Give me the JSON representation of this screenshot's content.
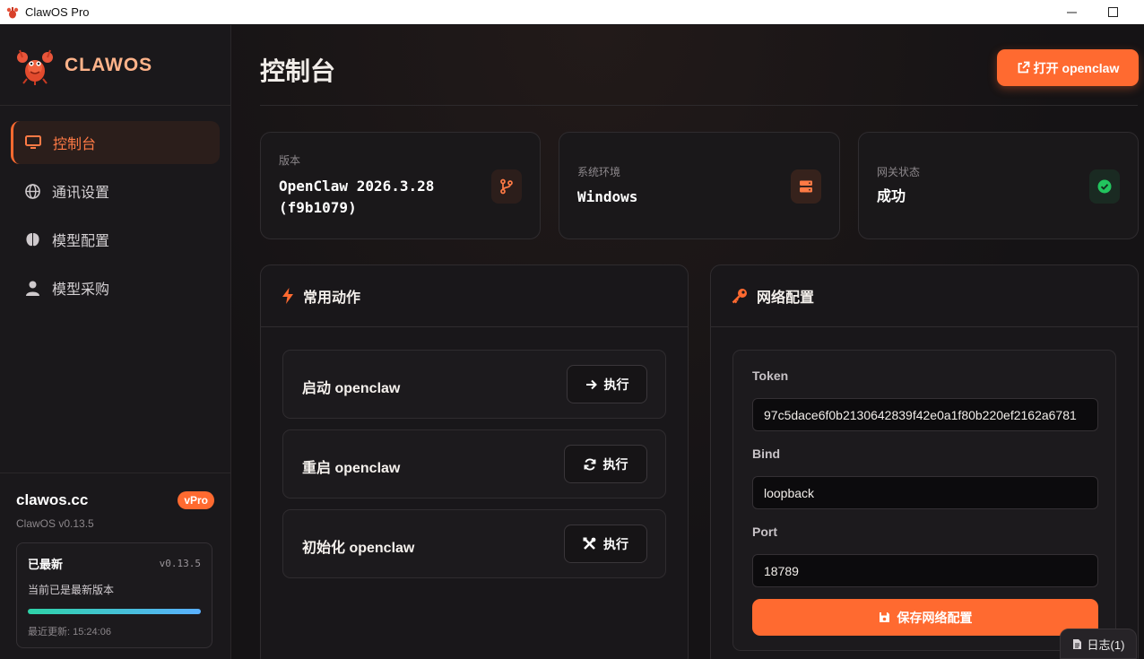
{
  "window": {
    "title": "ClawOS Pro",
    "icon": "lobster-icon",
    "minimize_icon": "minimize-icon",
    "maximize_icon": "maximize-icon"
  },
  "sidebar": {
    "brand": "CLAWOS",
    "items": [
      {
        "label": "控制台",
        "icon": "monitor-icon",
        "active": true
      },
      {
        "label": "通讯设置",
        "icon": "globe-icon",
        "active": false
      },
      {
        "label": "模型配置",
        "icon": "brain-icon",
        "active": false
      },
      {
        "label": "模型采购",
        "icon": "user-icon",
        "active": false
      }
    ],
    "footer": {
      "site": "clawos.cc",
      "badge": "vPro",
      "app_version": "ClawOS v0.13.5",
      "update": {
        "status": "已最新",
        "version": "v0.13.5",
        "message": "当前已是最新版本",
        "progress": 1.0,
        "last_updated": "最近更新: 15:24:06"
      }
    }
  },
  "main": {
    "title": "控制台",
    "open_button": "打开 openclaw",
    "stats": [
      {
        "label": "版本",
        "value": "OpenClaw 2026.3.28 (f9b1079)",
        "icon": "git-branch-icon"
      },
      {
        "label": "系统环境",
        "value": "Windows",
        "icon": "server-icon"
      },
      {
        "label": "网关状态",
        "value": "成功",
        "icon": "check-circle-icon"
      }
    ],
    "actions_panel": {
      "title": "常用动作",
      "icon": "bolt-icon",
      "actions": [
        {
          "label": "启动 openclaw",
          "button": "执行",
          "icon": "arrow-right-icon"
        },
        {
          "label": "重启 openclaw",
          "button": "执行",
          "icon": "refresh-icon"
        },
        {
          "label": "初始化 openclaw",
          "button": "执行",
          "icon": "tools-icon"
        }
      ]
    },
    "network_panel": {
      "title": "网络配置",
      "icon": "key-icon",
      "token_label": "Token",
      "token_value": "97c5dace6f0b2130642839f42e0a1f80b220ef2162a6781",
      "bind_label": "Bind",
      "bind_value": "loopback",
      "port_label": "Port",
      "port_value": "18789",
      "save_button": "保存网络配置"
    }
  },
  "log_button": "日志(1)",
  "colors": {
    "accent": "#ff6a30",
    "success": "#22c55e",
    "background": "#151315"
  }
}
